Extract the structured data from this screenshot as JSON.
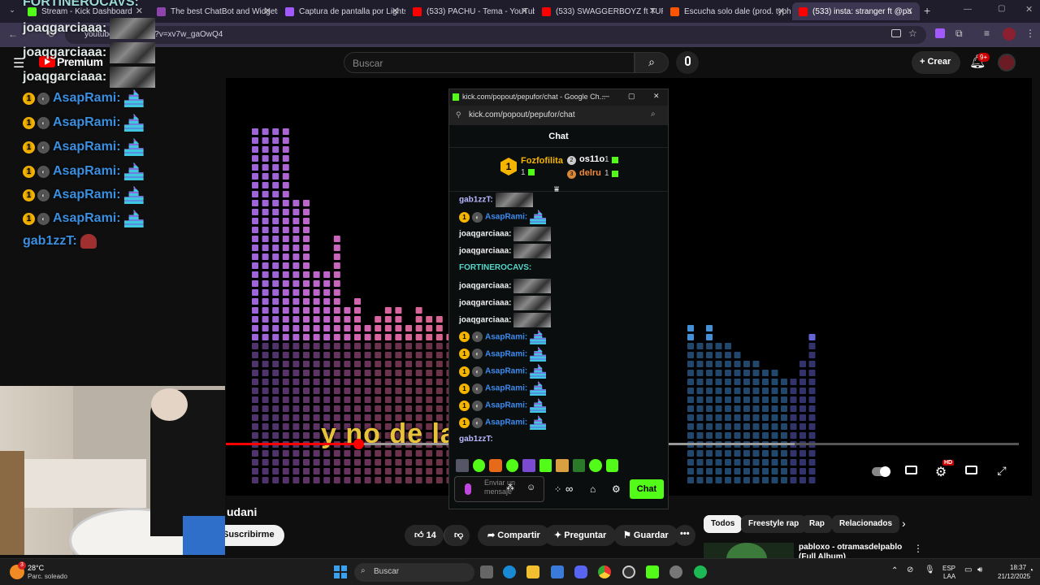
{
  "browser": {
    "tabs": [
      {
        "label": "Stream - Kick Dashboard",
        "color": "#53fc18"
      },
      {
        "label": "The best ChatBot and Widgets",
        "color": "#8e44ad"
      },
      {
        "label": "Captura de pantalla por Lightsi",
        "color": "#a259ff"
      },
      {
        "label": "(533) PACHU - Tema - YouTube",
        "color": "#ff0000"
      },
      {
        "label": "(533) SWAGGERBOYZ ft TURRO",
        "color": "#ff0000"
      },
      {
        "label": "Escucha solo dale (prod. typhe",
        "color": "#ff5500"
      },
      {
        "label": "(533) insta: stranger ft @pa",
        "color": "#ff0000"
      }
    ],
    "url": "youtube.com/watch?v=xv7w_gaOwQ4"
  },
  "youtube": {
    "logo_text": "Premium",
    "search_placeholder": "Buscar",
    "create_label": "Crear",
    "notif_count": "9+",
    "subtitle": "y no de la casa",
    "hd_badge": "HD",
    "title_fragment": "udani",
    "subscribe_label": "Suscribirme",
    "like_count": "14",
    "share_label": "Compartir",
    "ask_label": "Preguntar",
    "save_label": "Guardar",
    "chips": [
      "Todos",
      "Freestyle rap",
      "Rap",
      "Relacionados"
    ],
    "side_video_title": "pabloxo - otramasdelpablo (Full Album)"
  },
  "overlay_chat": {
    "rows": [
      {
        "user": "FORTINEROCAVS:",
        "kind": "header"
      },
      {
        "user": "joaqgarciaaa:",
        "kind": "user"
      },
      {
        "user": "joaqgarciaaa:",
        "kind": "user"
      },
      {
        "user": "joaqgarciaaa:",
        "kind": "user"
      },
      {
        "user": "AsapRami:",
        "kind": "badge"
      },
      {
        "user": "AsapRami:",
        "kind": "badge"
      },
      {
        "user": "AsapRami:",
        "kind": "badge"
      },
      {
        "user": "AsapRami:",
        "kind": "badge"
      },
      {
        "user": "AsapRami:",
        "kind": "badge"
      },
      {
        "user": "AsapRami:",
        "kind": "badge"
      },
      {
        "user": "gab1zzT:",
        "kind": "user"
      }
    ],
    "badge_label": "1"
  },
  "kick": {
    "window_title": "kick.com/popout/pepufor/chat - Google Ch...",
    "url": "kick.com/popout/pepufor/chat",
    "header": "Chat",
    "leaderboard": [
      {
        "rank": "1",
        "name": "Fozfofilita",
        "count": "1"
      },
      {
        "rank": "2",
        "name": "os11o",
        "count": "1"
      },
      {
        "rank": "3",
        "name": "delru",
        "count": "1"
      }
    ],
    "messages": [
      {
        "user": "gab1zzT:",
        "color": "c-lilac",
        "badges": false
      },
      {
        "user": "AsapRami:",
        "color": "c-blue",
        "badges": true
      },
      {
        "user": "joaqgarciaaa:",
        "color": "c-white",
        "badges": false
      },
      {
        "user": "joaqgarciaaa:",
        "color": "c-white",
        "badges": false
      },
      {
        "user": "FORTINEROCAVS:",
        "color": "c-teal",
        "badges": false
      },
      {
        "user": "joaqgarciaaa:",
        "color": "c-white",
        "badges": false
      },
      {
        "user": "joaqgarciaaa:",
        "color": "c-white",
        "badges": false
      },
      {
        "user": "joaqgarciaaa:",
        "color": "c-white",
        "badges": false
      },
      {
        "user": "AsapRami:",
        "color": "c-blue",
        "badges": true
      },
      {
        "user": "AsapRami:",
        "color": "c-blue",
        "badges": true
      },
      {
        "user": "AsapRami:",
        "color": "c-blue",
        "badges": true
      },
      {
        "user": "AsapRami:",
        "color": "c-blue",
        "badges": true
      },
      {
        "user": "AsapRami:",
        "color": "c-blue",
        "badges": true
      },
      {
        "user": "AsapRami:",
        "color": "c-blue",
        "badges": true
      },
      {
        "user": "gab1zzT:",
        "color": "c-lilac",
        "badges": false
      }
    ],
    "input_placeholder": "Enviar un mensaje",
    "send_label": "Chat",
    "accent": "#53fc18"
  },
  "taskbar": {
    "search_placeholder": "Buscar",
    "weather_temp": "28°C",
    "weather_desc": "Parc. soleado",
    "weather_badge": "3",
    "lang_top": "ESP",
    "lang_bottom": "LAA",
    "time": "18:37",
    "date": "21/12/2025"
  }
}
